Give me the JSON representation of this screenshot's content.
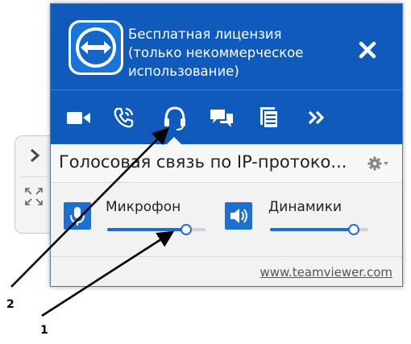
{
  "header": {
    "title_lines": [
      "Бесплатная лицензия",
      "(только некоммерческое",
      "использование)"
    ]
  },
  "toolbar": {
    "items": [
      {
        "icon": "video-icon"
      },
      {
        "icon": "phone-icon"
      },
      {
        "icon": "headset-icon"
      },
      {
        "icon": "chat-icon"
      },
      {
        "icon": "files-icon"
      },
      {
        "icon": "more-icon"
      }
    ]
  },
  "section": {
    "title": "Голосовая связь по IP-протоко..."
  },
  "audio": {
    "microphone": {
      "label": "Микрофон",
      "level": 0.8
    },
    "speakers": {
      "label": "Динамики",
      "level": 0.85
    }
  },
  "footer": {
    "link": "www.teamviewer.com"
  },
  "annotations": {
    "label_1": "1",
    "label_2": "2"
  },
  "colors": {
    "header_blue": "#0f5aba",
    "accent_blue": "#1d6fd1"
  }
}
